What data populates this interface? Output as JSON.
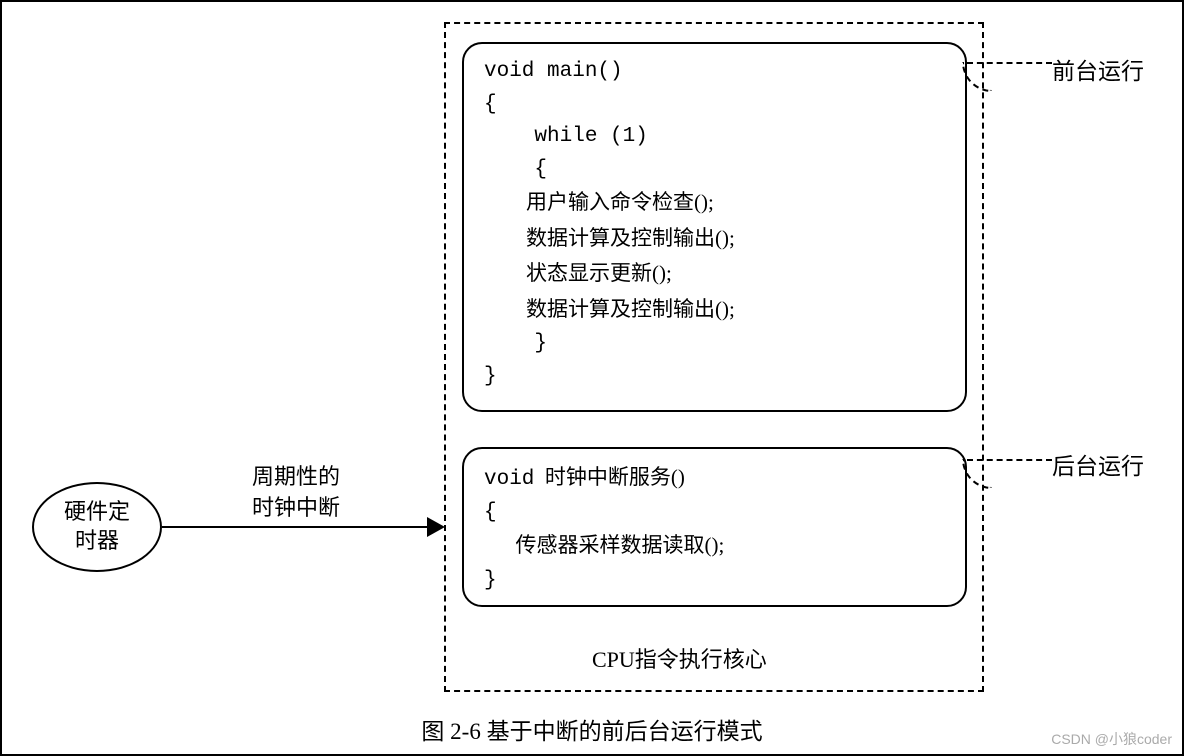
{
  "ellipse": {
    "line1": "硬件定",
    "line2": "时器"
  },
  "arrow": {
    "label_line1": "周期性的",
    "label_line2": "时钟中断"
  },
  "code_top": {
    "line1": "void main()",
    "line2": "{",
    "line3": "    while (1)",
    "line4": "    {",
    "line5": "        用户输入命令检查();",
    "line6": "        数据计算及控制输出();",
    "line7": "        状态显示更新();",
    "line8": "        数据计算及控制输出();",
    "line9": "    }",
    "line10": "}"
  },
  "code_bottom": {
    "line1_a": "void",
    "line1_b": "  时钟中断服务()",
    "line2": "{",
    "line3": "      传感器采样数据读取();",
    "line4": "}"
  },
  "labels": {
    "cpu": "CPU指令执行核心",
    "foreground": "前台运行",
    "background": "后台运行"
  },
  "caption": "图 2-6  基于中断的前后台运行模式",
  "watermark": "CSDN @小狼coder"
}
